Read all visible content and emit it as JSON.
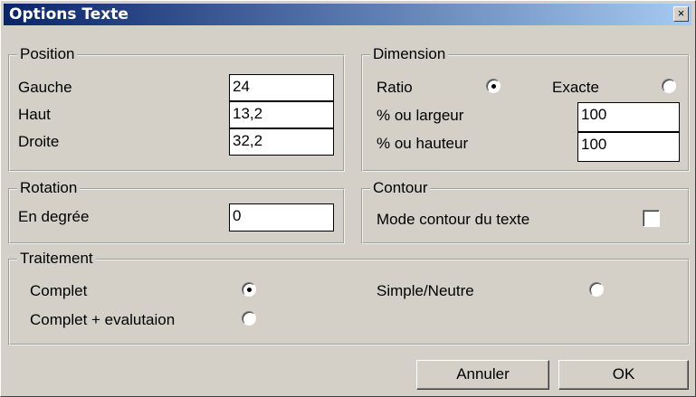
{
  "dialog": {
    "title": "Options Texte",
    "close_symbol": "×"
  },
  "position": {
    "legend": "Position",
    "gauche_label": "Gauche",
    "gauche_value": "24",
    "haut_label": "Haut",
    "haut_value": "13,2",
    "droite_label": "Droite",
    "droite_value": "32,2"
  },
  "dimension": {
    "legend": "Dimension",
    "ratio_label": "Ratio",
    "ratio_selected": true,
    "exacte_label": "Exacte",
    "exacte_selected": false,
    "largeur_label": "% ou largeur",
    "largeur_value": "100",
    "hauteur_label": "% ou hauteur",
    "hauteur_value": "100"
  },
  "rotation": {
    "legend": "Rotation",
    "degree_label": "En degrée",
    "degree_value": "0"
  },
  "contour": {
    "legend": "Contour",
    "mode_label": "Mode contour du texte",
    "mode_checked": false
  },
  "traitement": {
    "legend": "Traitement",
    "complet_label": "Complet",
    "complet_selected": true,
    "simple_label": "Simple/Neutre",
    "simple_selected": false,
    "evaluation_label": "Complet + evalutaion",
    "evaluation_selected": false
  },
  "buttons": {
    "cancel": "Annuler",
    "ok": "OK"
  }
}
